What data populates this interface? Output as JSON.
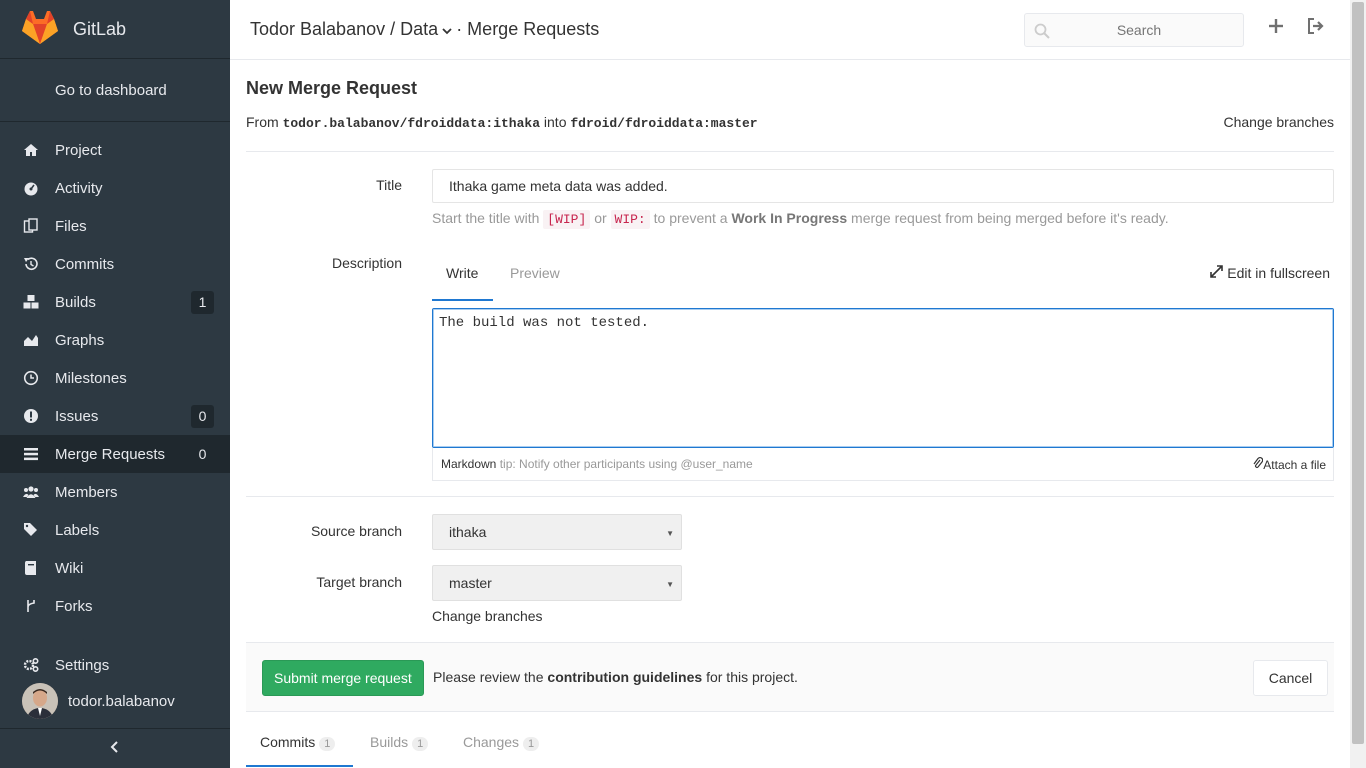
{
  "app": {
    "name": "GitLab"
  },
  "sidebar": {
    "dashboard_label": "Go to dashboard",
    "items": [
      {
        "label": "Project",
        "icon": "home-icon",
        "badge": ""
      },
      {
        "label": "Activity",
        "icon": "dashboard-icon",
        "badge": ""
      },
      {
        "label": "Files",
        "icon": "files-icon",
        "badge": ""
      },
      {
        "label": "Commits",
        "icon": "history-icon",
        "badge": ""
      },
      {
        "label": "Builds",
        "icon": "cubes-icon",
        "badge": "1"
      },
      {
        "label": "Graphs",
        "icon": "area-chart-icon",
        "badge": ""
      },
      {
        "label": "Milestones",
        "icon": "clock-icon",
        "badge": ""
      },
      {
        "label": "Issues",
        "icon": "exclamation-circle-icon",
        "badge": "0"
      },
      {
        "label": "Merge Requests",
        "icon": "list-icon",
        "badge": "0"
      },
      {
        "label": "Members",
        "icon": "users-icon",
        "badge": ""
      },
      {
        "label": "Labels",
        "icon": "tags-icon",
        "badge": ""
      },
      {
        "label": "Wiki",
        "icon": "book-icon",
        "badge": ""
      },
      {
        "label": "Forks",
        "icon": "code-fork-icon",
        "badge": ""
      },
      {
        "label": "Settings",
        "icon": "cogs-icon",
        "badge": ""
      }
    ],
    "active_item": "Merge Requests",
    "username": "todor.balabanov",
    "collapse_icon": "chevron-left-icon"
  },
  "header": {
    "owner": "Todor Balabanov",
    "separator": "/",
    "project": "Data",
    "section": "· Merge Requests",
    "search_placeholder": "Search"
  },
  "page": {
    "title": "New Merge Request",
    "from_label": "From",
    "source_ref": "todor.balabanov/fdroiddata:ithaka",
    "into_label": "into",
    "target_ref": "fdroid/fdroiddata:master",
    "change_branches": "Change branches"
  },
  "form": {
    "title_label": "Title",
    "title_value": "Ithaka game meta data was added.",
    "hint_start": "Start the title with",
    "hint_wip1": "[WIP]",
    "hint_or": "or",
    "hint_wip2": "WIP:",
    "hint_mid": "to prevent a",
    "hint_bold": "Work In Progress",
    "hint_end": "merge request from being merged before it's ready.",
    "description_label": "Description",
    "tab_write": "Write",
    "tab_preview": "Preview",
    "fullscreen": "Edit in fullscreen",
    "description_value": "The build was not tested.",
    "markdown_label": "Markdown",
    "markdown_tip": "tip: Notify other participants using @user_name",
    "attach_file": "Attach a file",
    "source_branch_label": "Source branch",
    "source_branch_value": "ithaka",
    "target_branch_label": "Target branch",
    "target_branch_value": "master",
    "change_branches": "Change branches"
  },
  "actions": {
    "submit": "Submit merge request",
    "review_pre": "Please review the",
    "review_link": "contribution guidelines",
    "review_post": "for this project.",
    "cancel": "Cancel"
  },
  "bottom_tabs": [
    {
      "label": "Commits",
      "count": "1"
    },
    {
      "label": "Builds",
      "count": "1"
    },
    {
      "label": "Changes",
      "count": "1"
    }
  ],
  "colors": {
    "sidebar_bg": "#2d3942",
    "submit_green": "#2faa60",
    "link_blue": "#1f78d1",
    "logo_orange": "#e24329"
  }
}
